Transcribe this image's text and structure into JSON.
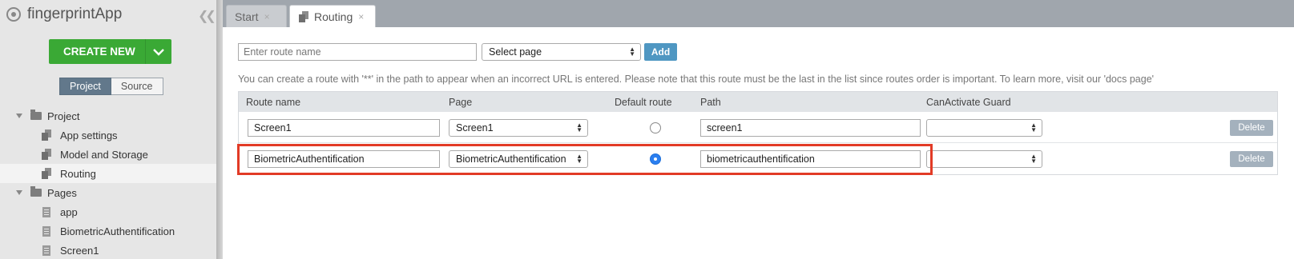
{
  "sidebar": {
    "app_title": "fingerprintApp",
    "create_button_label": "CREATE NEW",
    "tabs": {
      "project": "Project",
      "source": "Source",
      "active": "Project"
    },
    "tree": {
      "project_folder": "Project",
      "project_items": [
        "App settings",
        "Model and Storage",
        "Routing"
      ],
      "selected_item": "Routing",
      "pages_folder": "Pages",
      "page_items": [
        "app",
        "BiometricAuthentification",
        "Screen1"
      ]
    }
  },
  "tabs": {
    "start": "Start",
    "routing": "Routing",
    "close_glyph": "×"
  },
  "toolbar": {
    "route_name_placeholder": "Enter route name",
    "select_page_label": "Select page",
    "add_label": "Add"
  },
  "info_text": "You can create a route with '**' in the path to appear when an incorrect URL is entered. Please note that this route must be the last in the list since routes order is important. To learn more, visit our 'docs page'",
  "table": {
    "headers": {
      "route_name": "Route name",
      "page": "Page",
      "default_route": "Default route",
      "path": "Path",
      "guard": "CanActivate Guard"
    },
    "rows": [
      {
        "route_name": "Screen1",
        "page": "Screen1",
        "default": false,
        "path": "screen1",
        "guard": "",
        "delete_label": "Delete"
      },
      {
        "route_name": "BiometricAuthentification",
        "page": "BiometricAuthentification",
        "default": true,
        "path": "biometricauthentification",
        "guard": "",
        "delete_label": "Delete"
      }
    ]
  },
  "colors": {
    "create_button": "#3aa935",
    "add_button": "#4f97c2",
    "highlight_border": "#e23b26",
    "radio_checked": "#2b7ff0"
  }
}
